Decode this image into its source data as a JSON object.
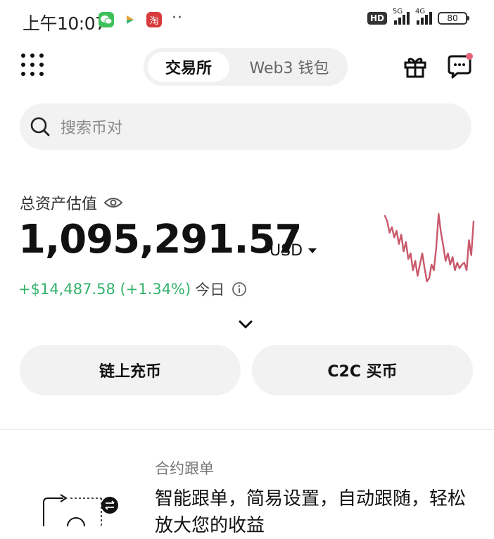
{
  "status_bar": {
    "time": "上午10:07",
    "app_icons": [
      "wechat-icon",
      "video-icon",
      "taobao-icon"
    ],
    "taobao_char": "淘",
    "more": "··",
    "hd": "HD",
    "net1": "5G",
    "net2": "4G",
    "battery": "80"
  },
  "header": {
    "tabs": [
      {
        "label": "交易所",
        "active": true
      },
      {
        "label": "Web3 钱包",
        "active": false
      }
    ]
  },
  "search": {
    "placeholder": "搜索币对"
  },
  "assets": {
    "label": "总资产估值",
    "amount": "1,095,291.57",
    "currency": "USD",
    "pnl": "+$14,487.58 (+1.34%)",
    "pnl_period": "今日",
    "sparkline_values": [
      78,
      72,
      60,
      66,
      55,
      62,
      48,
      58,
      40,
      50,
      32,
      38,
      20,
      30,
      14,
      26,
      38,
      22,
      8,
      12,
      26,
      20,
      44,
      80,
      60,
      46,
      30,
      38,
      26,
      34,
      20,
      28,
      22,
      26,
      28,
      20,
      52,
      36,
      72
    ]
  },
  "actions": {
    "deposit": "链上充币",
    "c2c": "C2C 买币"
  },
  "promo": {
    "title": "合约跟单",
    "text": "智能跟单，简易设置，自动跟随，轻松放大您的收益"
  },
  "colors": {
    "positive": "#33b36c",
    "sparkline": "#c9586b",
    "surface": "#f2f2f2"
  }
}
